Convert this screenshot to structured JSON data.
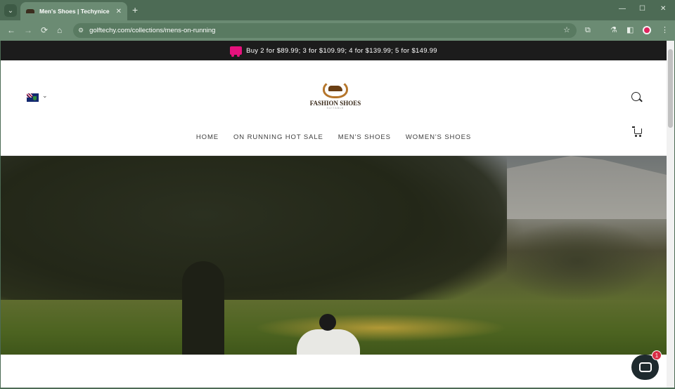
{
  "browser": {
    "tab_title": "Men's Shoes | Techynice",
    "tab_close_icon": "✕",
    "new_tab_icon": "+",
    "tab_list_icon": "⌄",
    "url": "golftechy.com/collections/mens-on-running",
    "window_controls": {
      "minimize": "—",
      "maximize": "☐",
      "close": "✕"
    },
    "nav_icons": {
      "back": "←",
      "forward": "→",
      "reload": "⟳",
      "home": "⌂",
      "site_info": "⚙",
      "bookmark": "☆"
    },
    "toolbar_icons": {
      "extensions": "⧉",
      "labs": "⚗",
      "side_panel": "◧",
      "menu": "⋮"
    }
  },
  "announcement": {
    "text": "Buy 2 for $89.99; 3 for $109.99; 4 for $139.99; 5 for $149.99",
    "icon": "truck-icon",
    "icon_color": "#e5127d"
  },
  "header": {
    "logo": {
      "name": "FASHION SHOES",
      "tagline": "SUITABLE"
    },
    "country_chevron": "⌄",
    "nav": [
      "HOME",
      "ON RUNNING HOT SALE",
      "MEN'S SHOES",
      "WOMEN'S SHOES"
    ]
  },
  "chat": {
    "badge": "1"
  },
  "colors": {
    "announce_bg": "#1c1c1c",
    "chrome_bg": "#4d6b55",
    "chat_bg": "#1e2a2e",
    "badge_bg": "#d72c44"
  }
}
